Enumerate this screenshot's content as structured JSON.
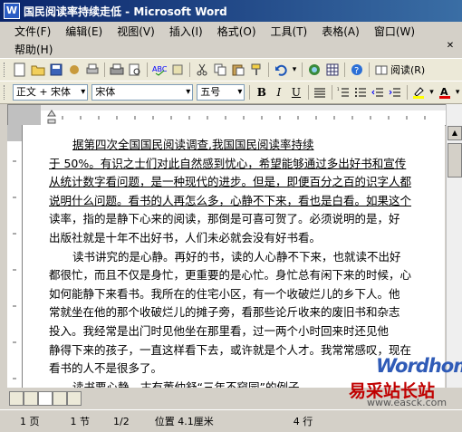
{
  "window": {
    "title": "国民阅读率持续走低 - Microsoft Word"
  },
  "menu": {
    "items": [
      "文件(F)",
      "编辑(E)",
      "视图(V)",
      "插入(I)",
      "格式(O)",
      "工具(T)",
      "表格(A)",
      "窗口(W)"
    ],
    "help": "帮助(H)"
  },
  "toolbar": {
    "read_label": "阅读(R)",
    "style_value": "正文 + 宋体",
    "font_value": "宋体",
    "size_value": "五号"
  },
  "document": {
    "paragraphs": [
      "据第四次全国国民阅读调查,我国国民阅读率持续",
      "于 50%。有识之士们对此自然感到忧心，希望能够通过多出好书和宣传",
      "从统计数字看问题，是一种现代的进步。但是，即便百分之百的识字人都",
      "说明什么问题。看书的人再怎么多，心静不下来，看也是白看。如果这个",
      "读率，指的是静下心来的阅读，那倒是可喜可贺了。必须说明的是，好",
      "出版社就是十年不出好书，人们未必就会没有好书看。",
      "读书讲究的是心静。再好的书，读的人心静不下来，也就读不出好",
      "都很忙，而且不仅是身忙，更重要的是心忙。身忙总有闲下来的时候，心",
      "如何能静下来看书。我所在的住宅小区，有一个收破烂儿的乡下人。他",
      "常就坐在他的那个收破烂儿的摊子旁，看那些论斤收来的废旧书和杂志",
      "投入。我经常是出门时见他坐在那里看，过一两个小时回来时还见他",
      "静得下来的孩子，一直这样看下去，或许就是个人才。我常常感叹，现在",
      "看书的人不是很多了。",
      "读书要心静。古有董仲舒“三年不窥园”的例子"
    ]
  },
  "status": {
    "page": "1 页",
    "section": "1 节",
    "page_of": "1/2",
    "position": "位置 4.1厘米",
    "line": "4 行"
  },
  "watermark": {
    "brand": "Wordhome",
    "site_cn": "易采站长站",
    "url": "www.easck.com"
  }
}
